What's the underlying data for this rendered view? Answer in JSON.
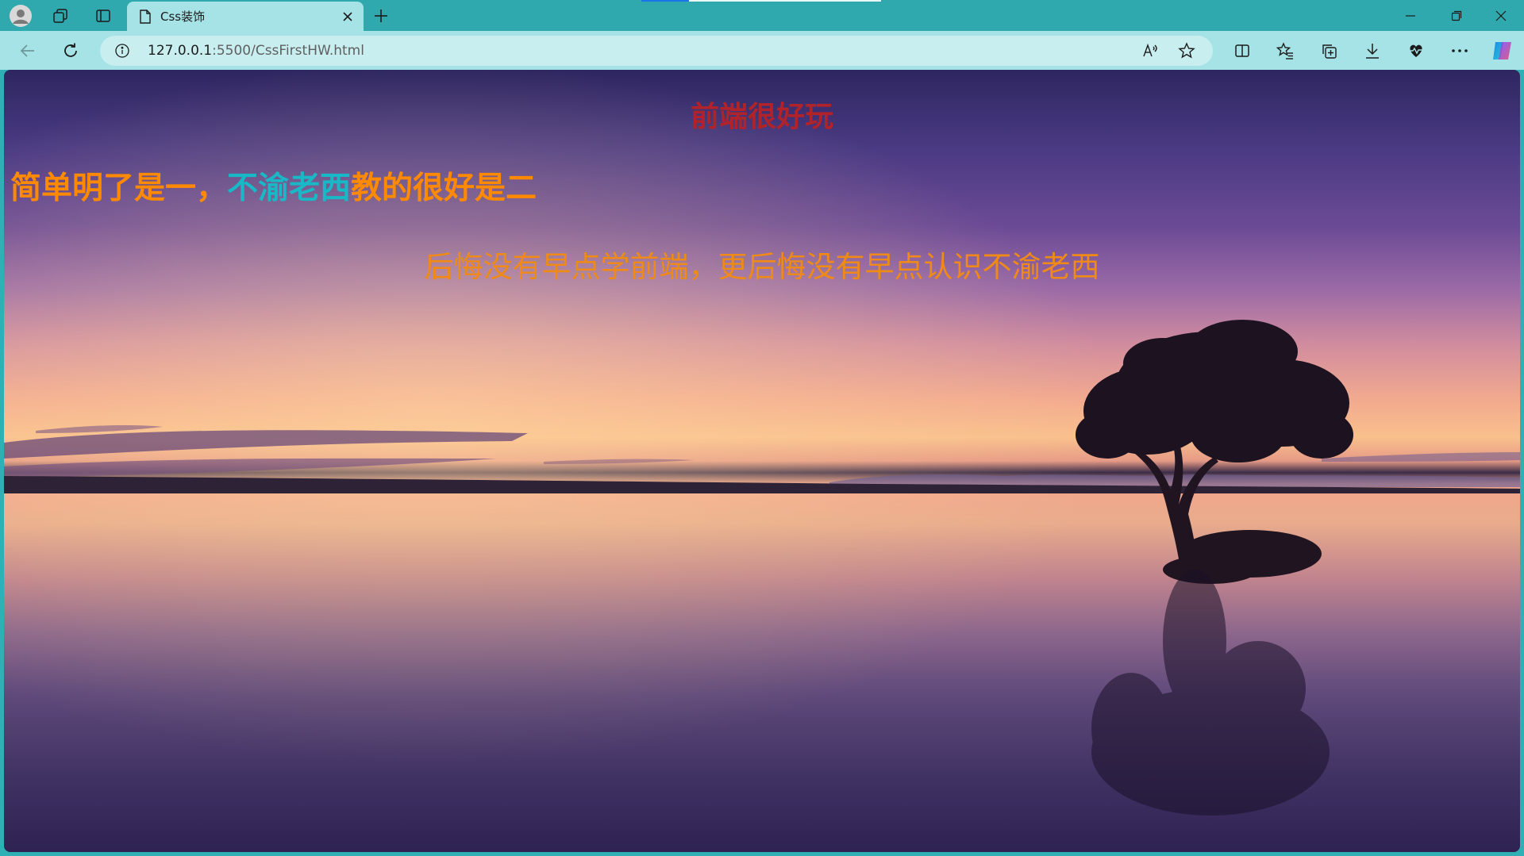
{
  "browser": {
    "tab": {
      "title": "Css装饰"
    },
    "address": {
      "host": "127.0.0.1",
      "rest": ":5500/CssFirstHW.html"
    },
    "icons": {
      "profile": "profile-icon",
      "workspaces": "workspaces-icon",
      "tab_actions": "tab-actions-icon",
      "page": "page-icon",
      "close_tab": "close-icon",
      "new_tab": "plus-icon",
      "minimize": "minimize-icon",
      "restore": "restore-icon",
      "close_window": "close-window-icon",
      "back": "back-arrow-icon",
      "refresh": "refresh-icon",
      "info": "info-icon",
      "read_aloud": "read-aloud-icon",
      "favorite": "star-icon",
      "split_screen": "split-screen-icon",
      "favorites": "favorites-icon",
      "collections": "collections-icon",
      "downloads": "download-icon",
      "heart_rate": "performance-icon",
      "more": "more-icon",
      "copilot": "copilot-icon"
    }
  },
  "page": {
    "heading1": "前端很好玩",
    "heading2_part1": "简单明了是一，",
    "heading2_accent": "不渝老西",
    "heading2_part2": "教的很好是二",
    "paragraph": "后悔没有早点学前端，更后悔没有早点认识不渝老西",
    "colors": {
      "heading1": "#b0232a",
      "heading2": "#ff8a00",
      "accent": "#18b8c6",
      "paragraph": "#f08a17"
    }
  }
}
